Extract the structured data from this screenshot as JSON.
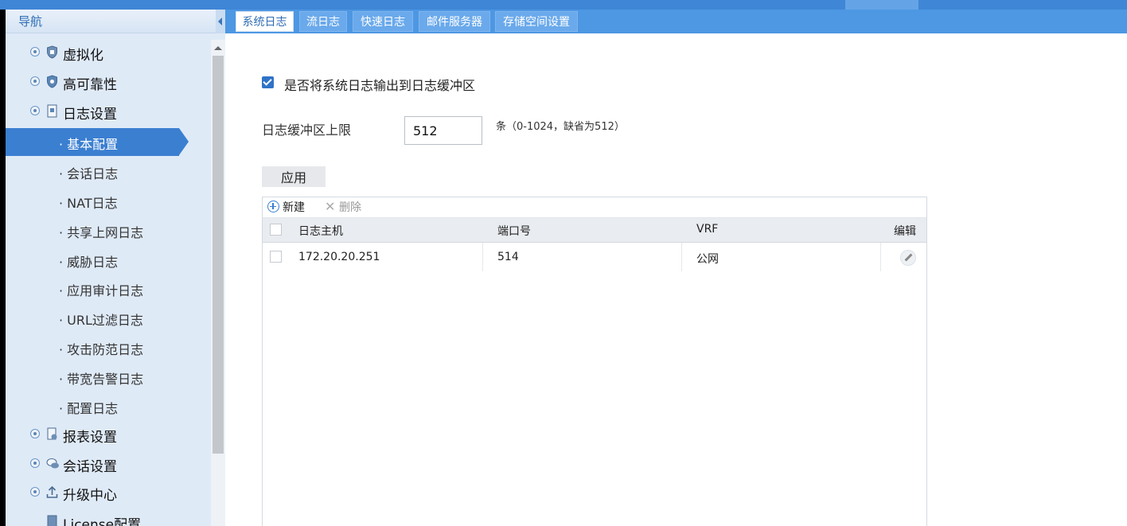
{
  "sidebar": {
    "title": "导航",
    "groups_top": [
      {
        "label": "虚拟化",
        "icon": "shield-icon"
      },
      {
        "label": "高可靠性",
        "icon": "shield-icon"
      },
      {
        "label": "日志设置",
        "icon": "document-icon"
      }
    ],
    "log_items": [
      {
        "label": "· 基本配置",
        "selected": true
      },
      {
        "label": "· 会话日志"
      },
      {
        "label": "· NAT日志"
      },
      {
        "label": "· 共享上网日志"
      },
      {
        "label": "· 威胁日志"
      },
      {
        "label": "· 应用审计日志"
      },
      {
        "label": "· URL过滤日志"
      },
      {
        "label": "· 攻击防范日志"
      },
      {
        "label": "· 带宽告警日志"
      },
      {
        "label": "· 配置日志"
      }
    ],
    "groups_bottom": [
      {
        "label": "报表设置",
        "icon": "report-icon"
      },
      {
        "label": "会话设置",
        "icon": "chat-icon"
      },
      {
        "label": "升级中心",
        "icon": "upload-icon"
      }
    ],
    "partial_item": "License配置"
  },
  "tabs": [
    {
      "label": "系统日志",
      "active": true
    },
    {
      "label": "流日志"
    },
    {
      "label": "快速日志"
    },
    {
      "label": "邮件服务器"
    },
    {
      "label": "存储空间设置"
    }
  ],
  "form": {
    "output_checkbox_label": "是否将系统日志输出到日志缓冲区",
    "output_checked": true,
    "buffer_limit_label": "日志缓冲区上限",
    "buffer_limit_value": "512",
    "buffer_limit_hint": "条（0-1024，缺省为512）",
    "apply_label": "应用"
  },
  "table": {
    "toolbar": {
      "new_label": "新建",
      "delete_label": "删除"
    },
    "headers": {
      "host": "日志主机",
      "port": "端口号",
      "vrf": "VRF",
      "edit": "编辑"
    },
    "rows": [
      {
        "host": "172.20.20.251",
        "port": "514",
        "vrf": "公网"
      }
    ]
  },
  "colors": {
    "accent": "#3b7fd1",
    "tabbar": "#4d97e3",
    "sidebar_bg": "#dfeaf7"
  }
}
